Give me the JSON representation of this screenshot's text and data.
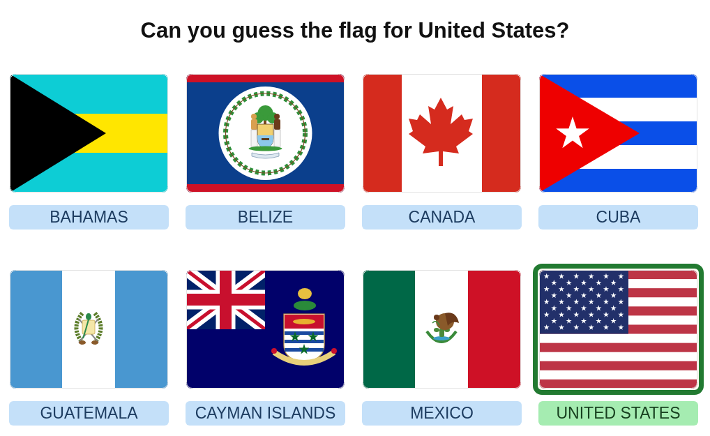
{
  "title": "Can you guess the flag for United States?",
  "options": [
    {
      "kind": "bahamas",
      "label": "BAHAMAS",
      "selected": false
    },
    {
      "kind": "belize",
      "label": "BELIZE",
      "selected": false
    },
    {
      "kind": "canada",
      "label": "CANADA",
      "selected": false
    },
    {
      "kind": "cuba",
      "label": "CUBA",
      "selected": false
    },
    {
      "kind": "guatemala",
      "label": "GUATEMALA",
      "selected": false
    },
    {
      "kind": "cayman",
      "label": "CAYMAN ISLANDS",
      "selected": false
    },
    {
      "kind": "mexico",
      "label": "MEXICO",
      "selected": false
    },
    {
      "kind": "usa",
      "label": "UNITED STATES",
      "selected": true
    }
  ]
}
